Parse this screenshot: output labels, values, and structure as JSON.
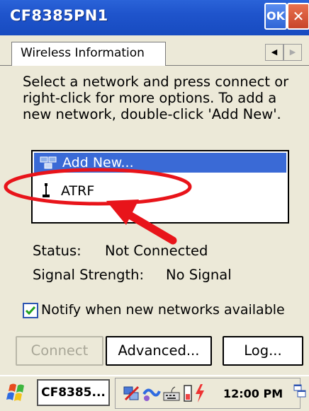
{
  "window": {
    "title": "CF8385PN1",
    "ok_label": "OK",
    "close_glyph": "✕"
  },
  "tabs": [
    {
      "label": "Wireless Information"
    }
  ],
  "instructions": "Select a network and press connect or right-click for more options.  To add a new network, double-click 'Add New'.",
  "networks": [
    {
      "label": "Add New...",
      "icon": "add-network-icon",
      "selected": true
    },
    {
      "label": "ATRF",
      "icon": "antenna-icon",
      "selected": false
    }
  ],
  "status": {
    "label": "Status:",
    "value": "Not Connected"
  },
  "signal": {
    "label": "Signal Strength:",
    "value": "No Signal"
  },
  "notify": {
    "label": "Notify when new networks available",
    "checked": true
  },
  "buttons": {
    "connect": "Connect",
    "advanced": "Advanced...",
    "log": "Log..."
  },
  "taskbar": {
    "task_label": "CF8385...",
    "time": "12:00 PM"
  },
  "colors": {
    "titlebar": "#2a63d8",
    "selection": "#3a6ad6",
    "annotation": "#e8141a"
  }
}
